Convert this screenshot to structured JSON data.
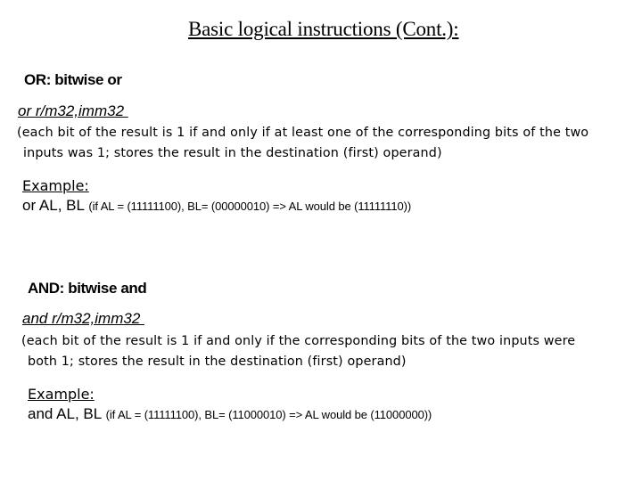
{
  "slide": {
    "title": "Basic logical instructions (Cont.):"
  },
  "or_section": {
    "heading": "OR: bitwise or",
    "syntax": "or r/m32,imm32 ",
    "description_line1": "(each bit of the result is 1 if and only if at least one of the corresponding bits of the two",
    "description_line2": "inputs was 1; stores the result in the destination (first) operand)",
    "example_label": "Example:",
    "example_instruction": "or AL, BL",
    "example_note": "(if AL = (11111100), BL= (00000010) => AL would be (11111110))"
  },
  "and_section": {
    "heading": "AND: bitwise and",
    "syntax": "and r/m32,imm32 ",
    "description_line1": "(each bit of the result is 1 if and only if the corresponding bits of the two inputs were",
    "description_line2": "both 1; stores the result in the destination (first) operand)",
    "example_label": "Example:",
    "example_instruction": "and AL, BL",
    "example_note": "(if AL = (11111100), BL= (11000010) => AL would be (11000000))"
  }
}
